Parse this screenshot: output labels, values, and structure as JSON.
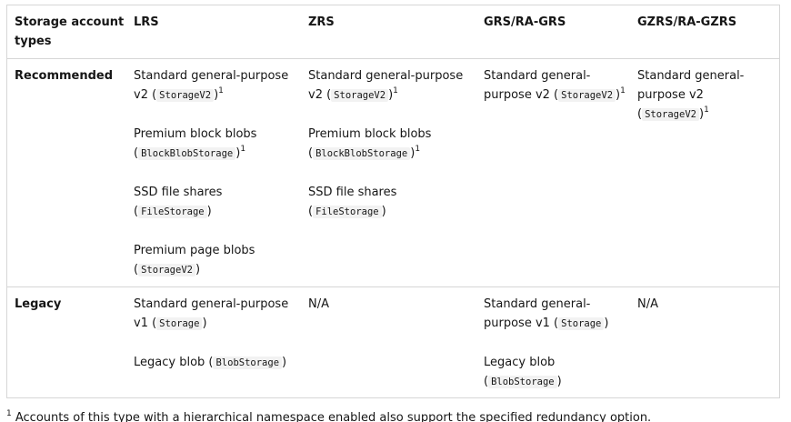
{
  "headers": [
    "Storage account types",
    "LRS",
    "ZRS",
    "GRS/RA-GRS",
    "GZRS/RA-GZRS"
  ],
  "rows": [
    {
      "label": "Recommended",
      "cells": [
        [
          {
            "text": "Standard general-purpose v2 (",
            "code": "StorageV2",
            "after": ")",
            "sup": "1"
          },
          {
            "text": "Premium block blobs (",
            "code": "BlockBlobStorage",
            "after": ")",
            "sup": "1"
          },
          {
            "text": "SSD file shares (",
            "code": "FileStorage",
            "after": ")",
            "sup": ""
          },
          {
            "text": "Premium page blobs (",
            "code": "StorageV2",
            "after": ")",
            "sup": ""
          }
        ],
        [
          {
            "text": "Standard general-purpose v2 (",
            "code": "StorageV2",
            "after": ")",
            "sup": "1"
          },
          {
            "text": "Premium block blobs (",
            "code": "BlockBlobStorage",
            "after": ")",
            "sup": "1"
          },
          {
            "text": "SSD file shares (",
            "code": "FileStorage",
            "after": ")",
            "sup": ""
          }
        ],
        [
          {
            "text": "Standard general-purpose v2 (",
            "code": "StorageV2",
            "after": ")",
            "sup": "1"
          }
        ],
        [
          {
            "text": "Standard general-purpose v2 (",
            "code": "StorageV2",
            "after": ")",
            "sup": "1"
          }
        ]
      ]
    },
    {
      "label": "Legacy",
      "cells": [
        [
          {
            "text": "Standard general-purpose v1 (",
            "code": "Storage",
            "after": ")",
            "sup": ""
          },
          {
            "text": "Legacy blob (",
            "code": "BlobStorage",
            "after": ")",
            "sup": ""
          }
        ],
        [
          {
            "text": "N/A",
            "code": "",
            "after": "",
            "sup": ""
          }
        ],
        [
          {
            "text": "Standard general-purpose v1 (",
            "code": "Storage",
            "after": ")",
            "sup": ""
          },
          {
            "text": "Legacy blob (",
            "code": "BlobStorage",
            "after": ")",
            "sup": ""
          }
        ],
        [
          {
            "text": "N/A",
            "code": "",
            "after": "",
            "sup": ""
          }
        ]
      ]
    }
  ],
  "footnote": {
    "marker": "1",
    "text": "Accounts of this type with a hierarchical namespace enabled also support the specified redundancy option."
  }
}
